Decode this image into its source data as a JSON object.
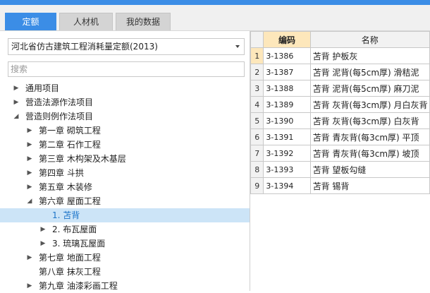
{
  "tabs": [
    {
      "label": "定额",
      "active": true
    },
    {
      "label": "人材机",
      "active": false
    },
    {
      "label": "我的数据",
      "active": false
    }
  ],
  "quota_select": {
    "value": "河北省仿古建筑工程消耗量定额(2013)"
  },
  "search": {
    "placeholder": "搜索"
  },
  "tree": [
    {
      "label": "通用项目",
      "level": 0,
      "state": "collapsed"
    },
    {
      "label": "营造法源作法项目",
      "level": 0,
      "state": "collapsed"
    },
    {
      "label": "营造则例作法项目",
      "level": 0,
      "state": "expanded"
    },
    {
      "label": "第一章 砌筑工程",
      "level": 1,
      "state": "collapsed"
    },
    {
      "label": "第二章 石作工程",
      "level": 1,
      "state": "collapsed"
    },
    {
      "label": "第三章 木构架及木基层",
      "level": 1,
      "state": "collapsed"
    },
    {
      "label": "第四章 斗拱",
      "level": 1,
      "state": "collapsed"
    },
    {
      "label": "第五章 木装修",
      "level": 1,
      "state": "collapsed"
    },
    {
      "label": "第六章 屋面工程",
      "level": 1,
      "state": "expanded"
    },
    {
      "label": "1. 苫背",
      "level": 2,
      "state": "leaf",
      "selected": true
    },
    {
      "label": "2. 布瓦屋面",
      "level": 2,
      "state": "collapsed"
    },
    {
      "label": "3. 琉璃瓦屋面",
      "level": 2,
      "state": "collapsed"
    },
    {
      "label": "第七章 地面工程",
      "level": 1,
      "state": "collapsed"
    },
    {
      "label": "第八章 抹灰工程",
      "level": 1,
      "state": "leaf"
    },
    {
      "label": "第九章 油漆彩画工程",
      "level": 1,
      "state": "collapsed"
    }
  ],
  "table": {
    "columns": [
      "",
      "编码",
      "名称"
    ],
    "rows": [
      {
        "idx": "1",
        "code": "3-1386",
        "name": "苫背 护板灰"
      },
      {
        "idx": "2",
        "code": "3-1387",
        "name": "苫背 泥背(每5cm厚) 滑秸泥"
      },
      {
        "idx": "3",
        "code": "3-1388",
        "name": "苫背 泥背(每5cm厚) 麻刀泥"
      },
      {
        "idx": "4",
        "code": "3-1389",
        "name": "苫背 灰背(每3cm厚) 月白灰背"
      },
      {
        "idx": "5",
        "code": "3-1390",
        "name": "苫背 灰背(每3cm厚) 白灰背"
      },
      {
        "idx": "6",
        "code": "3-1391",
        "name": "苫背 青灰背(每3cm厚) 平顶"
      },
      {
        "idx": "7",
        "code": "3-1392",
        "name": "苫背 青灰背(每3cm厚) 坡顶"
      },
      {
        "idx": "8",
        "code": "3-1393",
        "name": "苫背 望板勾缝"
      },
      {
        "idx": "9",
        "code": "3-1394",
        "name": "苫背 锡背"
      }
    ]
  },
  "icons": {
    "collapsed": "triangle-right-icon",
    "expanded": "triangle-down-icon",
    "dropdown": "chevron-down-icon"
  },
  "colors": {
    "accent": "#3b8de6",
    "selected_row": "#cce4f7",
    "header_highlight": "#fde7bb"
  }
}
